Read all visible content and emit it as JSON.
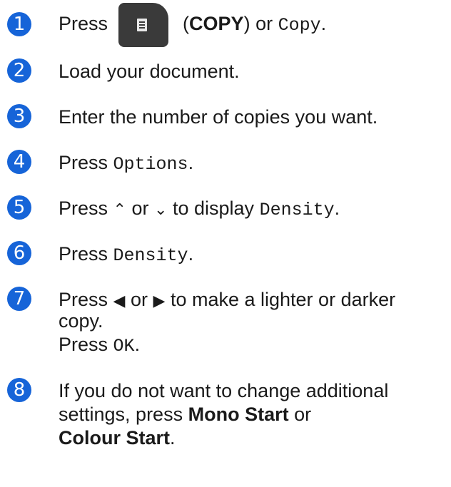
{
  "steps": [
    {
      "num": "1",
      "press": "Press",
      "btn": "COPY",
      "or": "or",
      "cmd": "Copy",
      "end": "."
    },
    {
      "num": "2",
      "text": "Load your document."
    },
    {
      "num": "3",
      "text": "Enter the number of copies you want."
    },
    {
      "num": "4",
      "press": "Press",
      "cmd": "Options",
      "end": "."
    },
    {
      "num": "5",
      "press": "Press",
      "up": "⌃",
      "or": "or",
      "down": "⌄",
      "mid": "to display",
      "cmd": "Density",
      "end": "."
    },
    {
      "num": "6",
      "press": "Press",
      "cmd": "Density",
      "end": "."
    },
    {
      "num": "7",
      "press": "Press",
      "left": "◀",
      "or": "or",
      "right": "▶",
      "line1": "to make a lighter or darker",
      "line2": "copy.",
      "press2": "Press",
      "cmd": "OK",
      "end": "."
    },
    {
      "num": "8",
      "line1": "If you do not want to change additional",
      "line2": "settings, press",
      "bold1": "Mono Start",
      "or": "or",
      "bold2": "Colour Start",
      "end": "."
    }
  ]
}
